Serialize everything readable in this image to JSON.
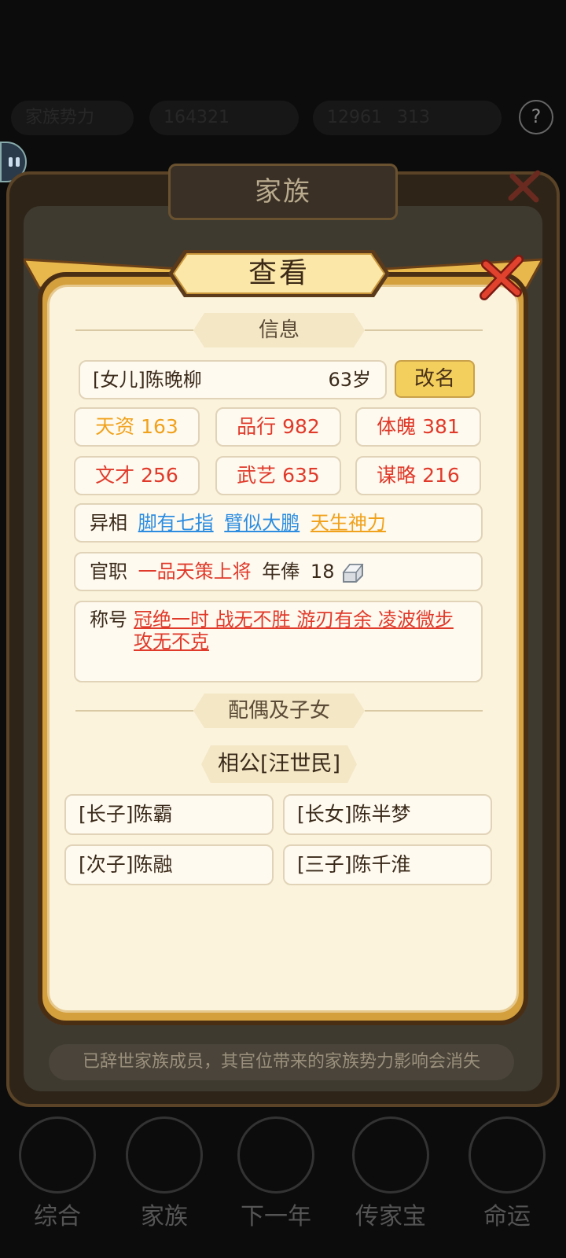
{
  "background": {
    "top_pills": [
      "家族势力",
      "164321",
      "12961",
      "313"
    ],
    "help_icon": "?",
    "family_panel_title": "家族",
    "footer_note": "已辞世家族成员，其官位带来的家族势力影响会消失",
    "nav": [
      "综合",
      "家族",
      "下一年",
      "传家宝",
      "命运"
    ]
  },
  "dialog": {
    "title": "查看",
    "info_header": "信息",
    "name": "[女儿]陈晚柳",
    "age": "63岁",
    "rename_label": "改名",
    "stats": [
      {
        "label": "天资",
        "value": "163",
        "color": "#f0a21c"
      },
      {
        "label": "品行",
        "value": "982",
        "color": "#e03a2a"
      },
      {
        "label": "体魄",
        "value": "381",
        "color": "#e03a2a"
      },
      {
        "label": "文才",
        "value": "256",
        "color": "#e03a2a"
      },
      {
        "label": "武艺",
        "value": "635",
        "color": "#e03a2a"
      },
      {
        "label": "谋略",
        "value": "216",
        "color": "#e03a2a"
      }
    ],
    "traits_label": "异相",
    "traits": [
      {
        "text": "脚有七指",
        "color": "blue"
      },
      {
        "text": "臂似大鹏",
        "color": "blue"
      },
      {
        "text": "天生神力",
        "color": "gold"
      }
    ],
    "office_label": "官职",
    "office_value": "一品天策上将",
    "salary_label": "年俸",
    "salary_value": "18",
    "salary_icon": "silver-ingot-icon",
    "title_label": "称号",
    "titles_line1": "冠绝一时 战无不胜 游刃有余 凌波微步",
    "titles_line2": "攻无不克",
    "family_header": "配偶及子女",
    "spouse": "相公[汪世民]",
    "children": [
      "[长子]陈霸",
      "[长女]陈半梦",
      "[次子]陈融",
      "[三子]陈千淮"
    ]
  },
  "colors": {
    "accent_gold": "#d4a03d",
    "panel_cream": "#fbf3dc",
    "stat_red": "#e03a2a",
    "stat_orange": "#f0a21c",
    "link_blue": "#2c8de0"
  }
}
